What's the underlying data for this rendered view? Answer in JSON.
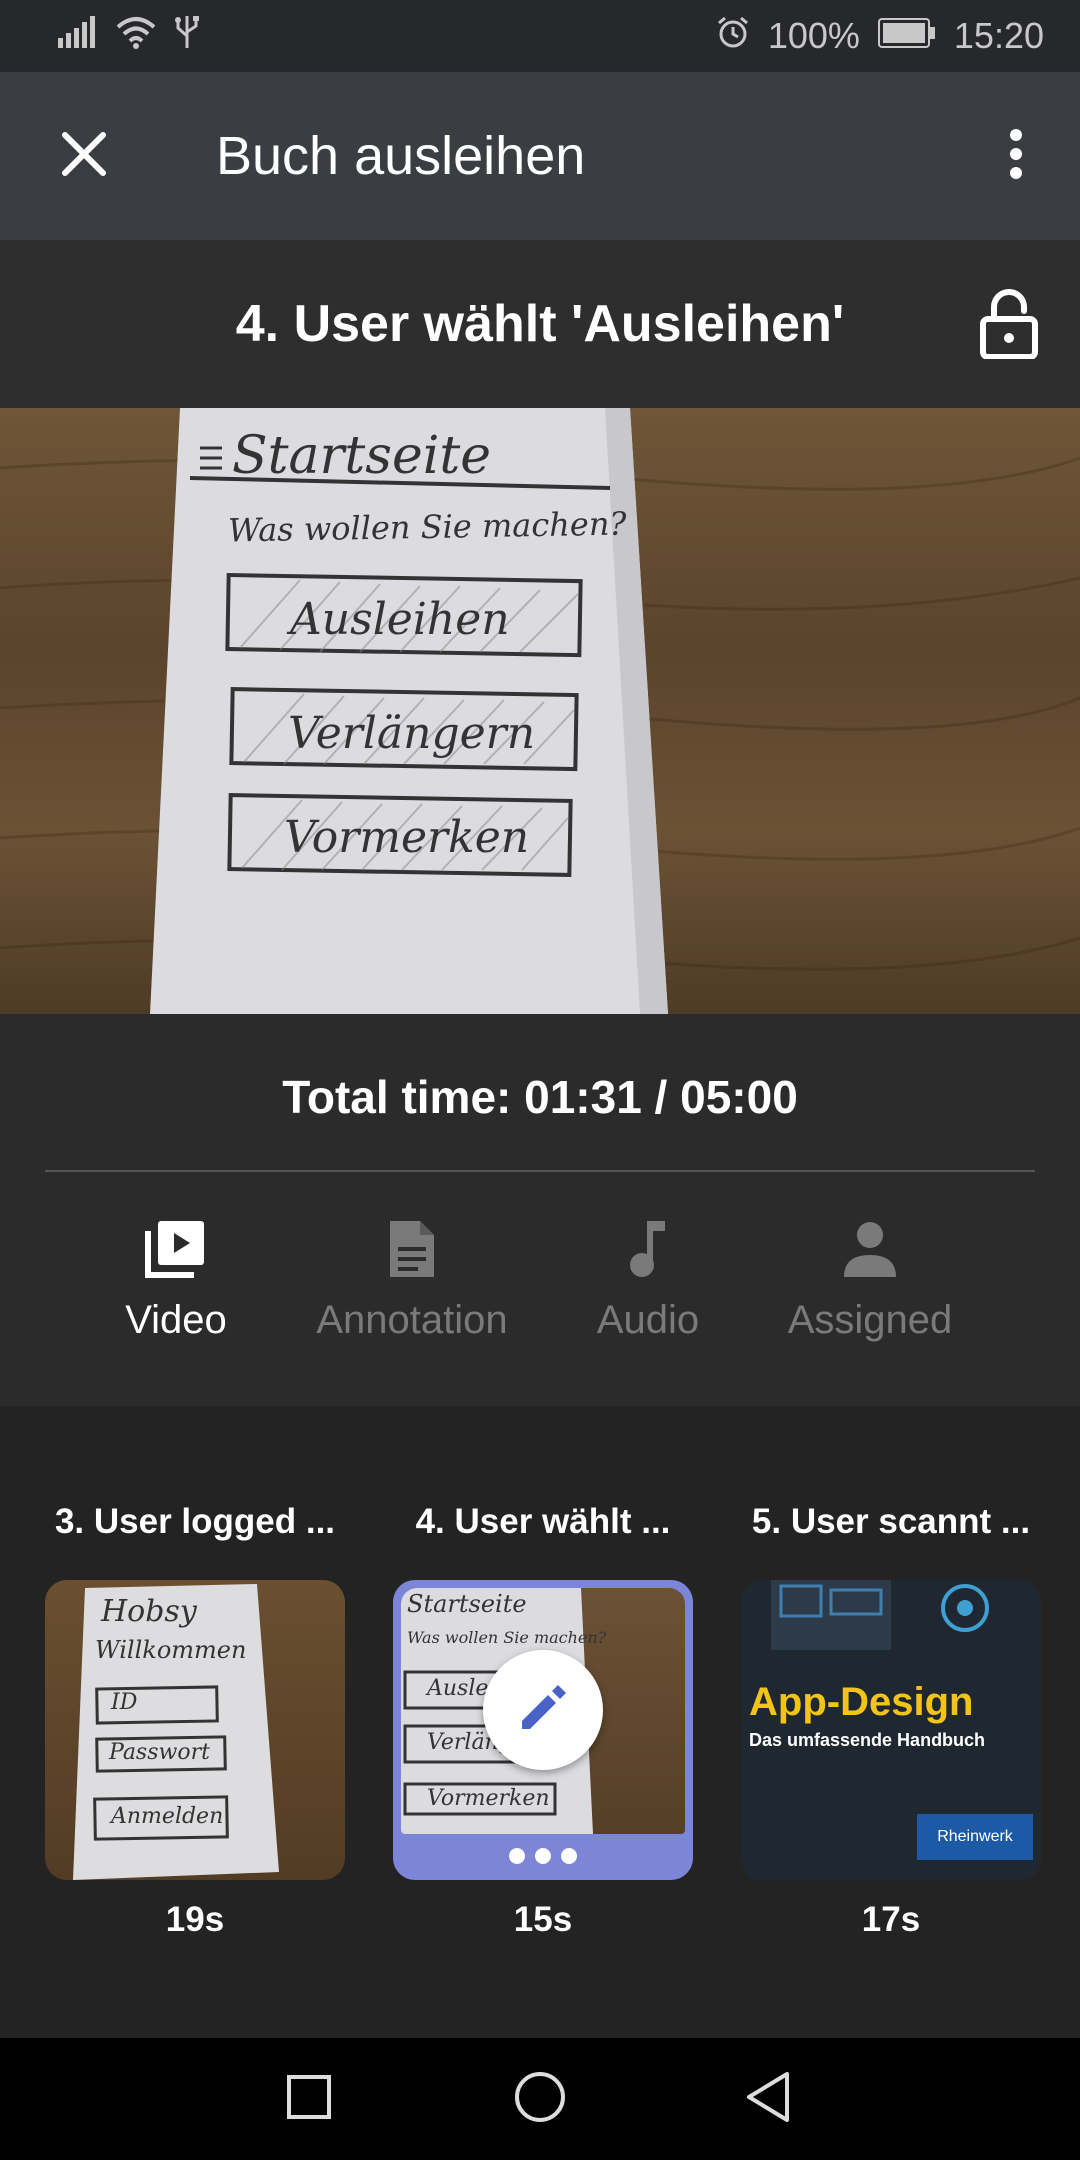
{
  "status_bar": {
    "battery": "100%",
    "time": "15:20",
    "icons": [
      "signal-icon",
      "wifi-icon",
      "usb-icon",
      "alarm-icon",
      "battery-icon"
    ]
  },
  "app_bar": {
    "title": "Buch ausleihen",
    "close_icon": "close-icon",
    "menu_icon": "more-vert-icon"
  },
  "step": {
    "title": "4. User wählt 'Ausleihen'",
    "lock_icon": "lock-open-icon"
  },
  "sketch_main": {
    "heading": "Startseite",
    "question": "Was wollen Sie machen?",
    "buttons": [
      "Ausleihen",
      "Verlängern",
      "Vormerken"
    ]
  },
  "total_time": "Total time: 01:31 / 05:00",
  "tabs": [
    {
      "label": "Video",
      "icon": "video-library-icon",
      "active": true
    },
    {
      "label": "Annotation",
      "icon": "document-icon",
      "active": false
    },
    {
      "label": "Audio",
      "icon": "music-note-icon",
      "active": false
    },
    {
      "label": "Assigned",
      "icon": "person-icon",
      "active": false
    }
  ],
  "steps": [
    {
      "title": "3. User logged ...",
      "duration": "19s",
      "sketch": {
        "line1": "Hobsy",
        "line2": "Willkommen",
        "fields": [
          "ID",
          "Passwort"
        ],
        "button": "Anmelden"
      }
    },
    {
      "title": "4. User wählt ...",
      "duration": "15s",
      "sketch": {
        "heading": "Startseite",
        "question": "Was wollen Sie machen?",
        "buttons": [
          "Ausleihen",
          "Verlängern",
          "Vormerken"
        ]
      }
    },
    {
      "title": "5. User scannt ...",
      "duration": "17s",
      "book": {
        "title": "App-Design",
        "subtitle": "Das umfassende Handbuch",
        "publisher": "Rheinwerk"
      }
    }
  ],
  "colors": {
    "accent": "#7b86d9",
    "edit_icon": "#4a63c9",
    "app_bar": "#3a3d42",
    "background": "#2b2b2b",
    "strip": "#232323",
    "book_title": "#f2c416"
  },
  "nav": [
    "recents-icon",
    "home-icon",
    "back-icon"
  ]
}
